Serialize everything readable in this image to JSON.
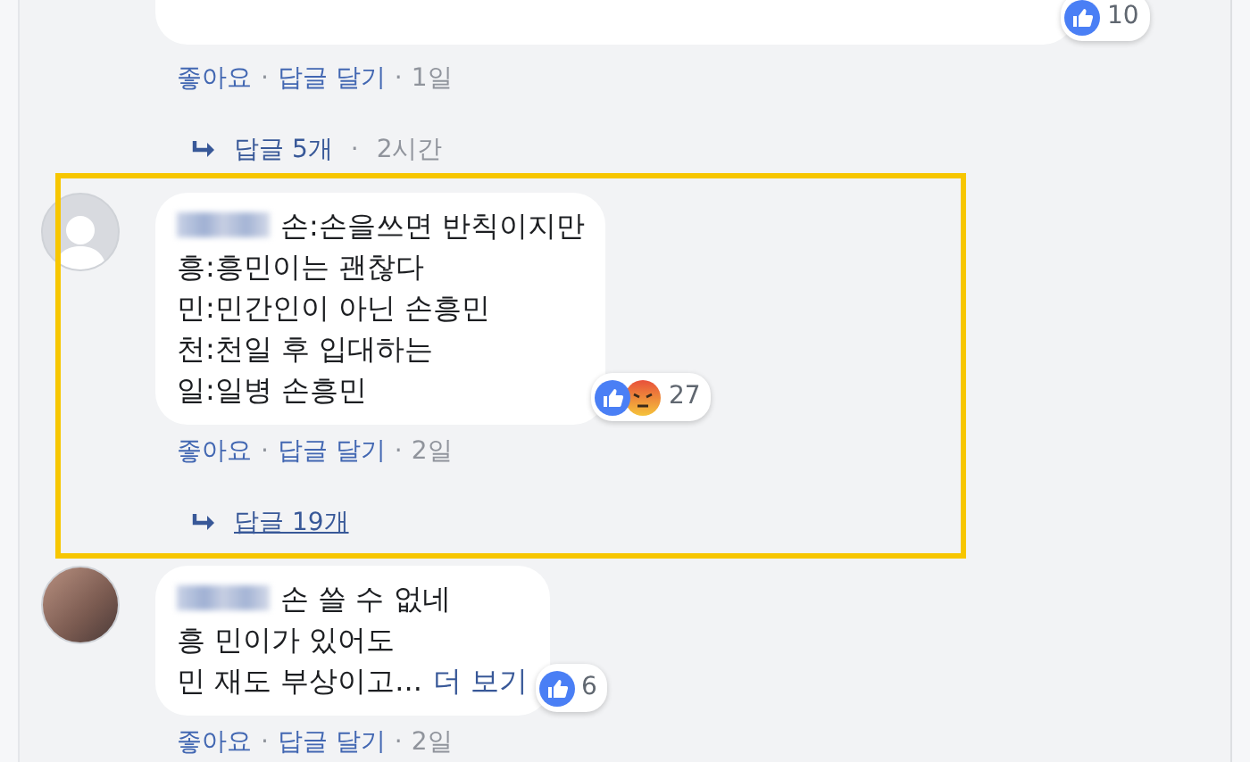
{
  "separator": "·",
  "comments": [
    {
      "cut_off_top": true,
      "reactions": [
        {
          "kind": "like"
        }
      ],
      "reaction_count": "10",
      "actions": [
        {
          "label": "좋아요"
        },
        {
          "label": "답글 달기"
        }
      ],
      "time": "1일",
      "replies": {
        "label": "답글 5개",
        "time": "2시간",
        "underlined": false
      },
      "highlighted": false
    },
    {
      "avatar": {
        "kind": "silhouette"
      },
      "author_blurred": true,
      "lines": [
        "손:손을쓰면 반칙이지만",
        "흥:흥민이는 괜찮다",
        "민:민간인이 아닌 손흥민",
        "천:천일 후 입대하는",
        "일:일병 손흥민"
      ],
      "reactions": [
        {
          "kind": "like"
        },
        {
          "kind": "angry"
        }
      ],
      "reaction_count": "27",
      "actions": [
        {
          "label": "좋아요"
        },
        {
          "label": "답글 달기"
        }
      ],
      "time": "2일",
      "replies": {
        "label": "답글 19개",
        "underlined": true
      },
      "highlighted": true
    },
    {
      "avatar": {
        "kind": "photo"
      },
      "author_blurred": true,
      "lines": [
        "손 쓸 수 없네",
        "흥 민이가 있어도",
        "민 재도 부상이고..."
      ],
      "see_more": "더 보기",
      "reactions": [
        {
          "kind": "like"
        }
      ],
      "reaction_count": "6",
      "actions": [
        {
          "label": "좋아요"
        },
        {
          "label": "답글 달기"
        }
      ],
      "time": "2일",
      "highlighted": false
    }
  ]
}
